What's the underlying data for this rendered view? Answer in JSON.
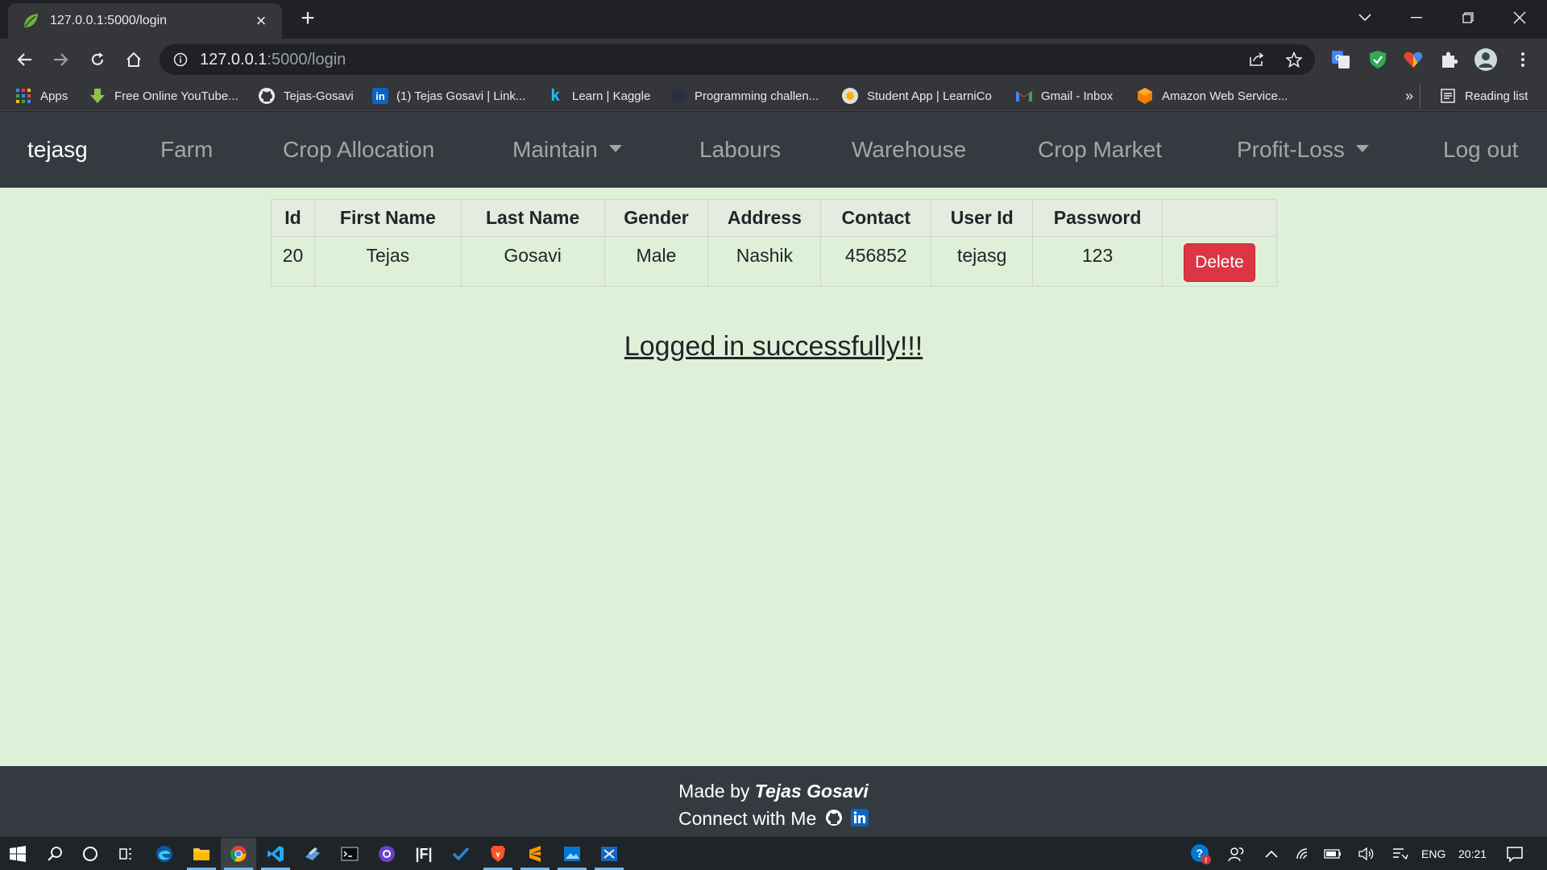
{
  "browser": {
    "tab_title": "127.0.0.1:5000/login",
    "url_host": "127.0.0.1",
    "url_rest": ":5000/login",
    "bookmarks": [
      {
        "label": "Apps",
        "icon": "apps-grid-icon"
      },
      {
        "label": "Free Online YouTube...",
        "icon": "download-arrow-icon"
      },
      {
        "label": "Tejas-Gosavi",
        "icon": "github-icon"
      },
      {
        "label": "(1) Tejas Gosavi | Link...",
        "icon": "linkedin-icon"
      },
      {
        "label": "Learn | Kaggle",
        "icon": "kaggle-icon"
      },
      {
        "label": "Programming challen...",
        "icon": "site-icon"
      },
      {
        "label": "Student App | LearniCo",
        "icon": "learnico-icon"
      },
      {
        "label": "Gmail - Inbox",
        "icon": "gmail-icon"
      },
      {
        "label": "Amazon Web Service...",
        "icon": "aws-icon"
      }
    ],
    "bookmarks_overflow": "»",
    "reading_list": "Reading list"
  },
  "navbar": {
    "brand": "tejasg",
    "items": [
      "Farm",
      "Crop Allocation",
      "Maintain",
      "Labours",
      "Warehouse",
      "Crop Market",
      "Profit-Loss",
      "Log out"
    ]
  },
  "table": {
    "headers": [
      "Id",
      "First Name",
      "Last Name",
      "Gender",
      "Address",
      "Contact",
      "User Id",
      "Password",
      ""
    ],
    "rows": [
      {
        "id": "20",
        "first_name": "Tejas",
        "last_name": "Gosavi",
        "gender": "Male",
        "address": "Nashik",
        "contact": "456852",
        "user_id": "tejasg",
        "password": "123",
        "action": "Delete"
      }
    ]
  },
  "message": "Logged in successfully!!!",
  "footer": {
    "made_by_prefix": "Made by ",
    "author": "Tejas Gosavi",
    "connect": "Connect with Me"
  },
  "taskbar": {
    "language": "ENG",
    "time": "20:21"
  },
  "colors": {
    "navbar_bg": "#343a40",
    "page_bg": "#dff0d8",
    "delete_button": "#dc3545"
  }
}
